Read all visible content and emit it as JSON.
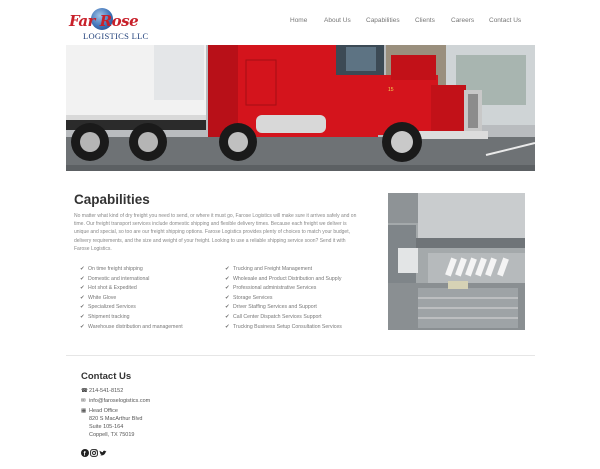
{
  "logo": {
    "script_text": "Far Rose",
    "sub_text": "LOGISTICS LLC"
  },
  "nav": {
    "items": [
      "Home",
      "About Us",
      "Capabilities",
      "Clients",
      "Careers",
      "Contact Us"
    ]
  },
  "main": {
    "title": "Capabilities",
    "intro": "No matter what kind of dry freight you need to send, or where it must go, Farose Logistics will make sure it arrives safely and on time. Our freight transport services include domestic shipping and flexible delivery times. Because each freight we deliver is unique and special, so too are our freight shipping options. Farose Logistics provides plenty of choices to match your budget, delivery requirements, and the size and weight of your freight. Looking to use a reliable shipping service soon? Send it with Farose Logistics.",
    "services_left": [
      "On time freight shipping",
      "Domestic and international",
      "Hot shot & Expedited",
      "White Glove",
      "Specialized Services",
      "Shipment tracking",
      "Warehouse distribution and management"
    ],
    "services_right": [
      "Trucking and Freight Management",
      "Wholesale and Product Distribution and Supply",
      "Professional administrative Services",
      "Storage Services",
      "Driver Staffing Services and Support",
      "Call Center Dispatch Services Support",
      "Trucking Business Setup Consultation Services"
    ]
  },
  "contact": {
    "title": "Contact Us",
    "phone": "214-541-8152",
    "email": "info@faroselogistics.com",
    "office_label": "Head Office",
    "address_lines": [
      "820 S MacArthur Blvd",
      "Suite 105-164",
      "Coppell, TX 75019"
    ]
  },
  "icons": {
    "check": "check-icon",
    "phone": "phone-icon",
    "email": "envelope-icon",
    "office": "building-icon",
    "social": [
      "facebook-icon",
      "instagram-icon",
      "twitter-icon"
    ]
  },
  "colors": {
    "brand_red": "#c8202a",
    "brand_blue": "#1f3f7a",
    "truck_red": "#d4141c"
  }
}
